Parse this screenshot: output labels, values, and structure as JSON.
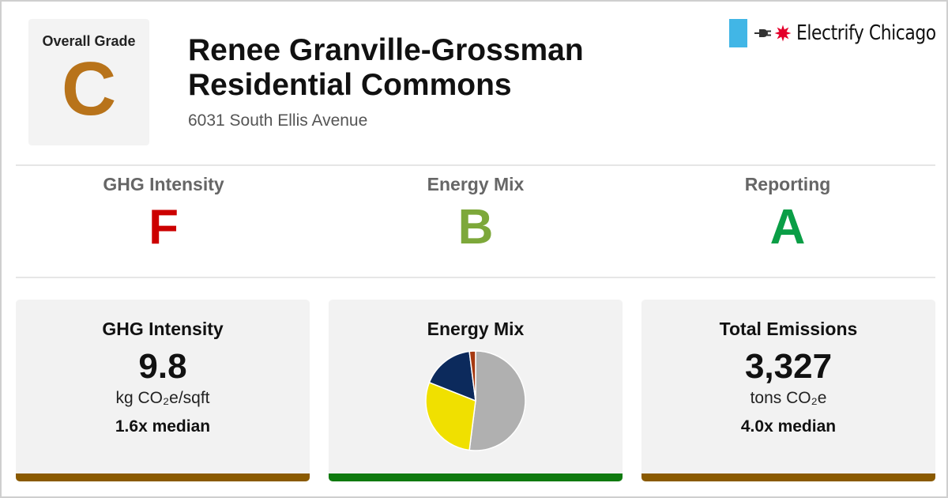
{
  "overall": {
    "label": "Overall Grade",
    "grade": "C",
    "color": "#b8731a"
  },
  "building": {
    "name": "Renee Granville-Grossman Residential Commons",
    "address": "6031 South Ellis Avenue"
  },
  "logo": {
    "text": "Electrify Chicago",
    "flag_color": "#41b6e6",
    "star_color": "#e4002b",
    "icons": [
      "plug-icon",
      "chicago-star-icon"
    ]
  },
  "sub_grades": [
    {
      "label": "GHG Intensity",
      "grade": "F",
      "color": "#cc0000"
    },
    {
      "label": "Energy Mix",
      "grade": "B",
      "color": "#7da83a"
    },
    {
      "label": "Reporting",
      "grade": "A",
      "color": "#0a9e46"
    }
  ],
  "cards": {
    "ghg": {
      "title": "GHG Intensity",
      "value": "9.8",
      "unit": "kg CO₂e/sqft",
      "median": "1.6x median",
      "bar_color": "#8a5a00"
    },
    "mix": {
      "title": "Energy Mix",
      "bar_color": "#0f7a0f"
    },
    "total": {
      "title": "Total Emissions",
      "value": "3,327",
      "unit": "tons CO₂e",
      "median": "4.0x median",
      "bar_color": "#8a5a00"
    }
  },
  "chart_data": {
    "type": "pie",
    "values": [
      52,
      29,
      17,
      2
    ],
    "colors": [
      "#b0b0b0",
      "#f0e000",
      "#0c2a5c",
      "#a63a12"
    ]
  }
}
